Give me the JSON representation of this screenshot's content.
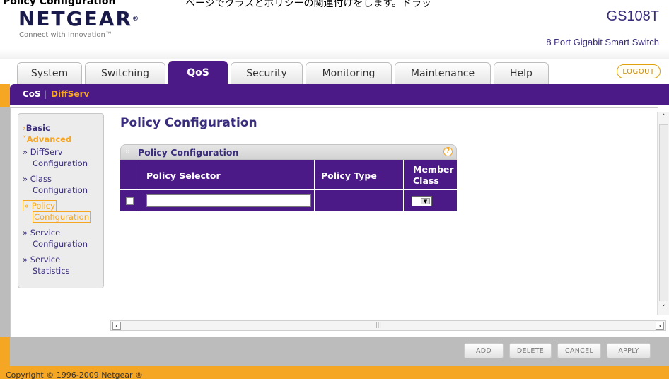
{
  "caption": {
    "left": "Policy Configuration",
    "right": "ページでクラスとポリシーの関連付けをします。ドラッ"
  },
  "header": {
    "brand": "NETGEAR",
    "tagline": "Connect with Innovation™",
    "model": "GS108T",
    "subtitle": "8 Port Gigabit Smart Switch",
    "logout": "LOGOUT"
  },
  "tabs": [
    {
      "label": "System",
      "active": false
    },
    {
      "label": "Switching",
      "active": false
    },
    {
      "label": "QoS",
      "active": true
    },
    {
      "label": "Security",
      "active": false
    },
    {
      "label": "Monitoring",
      "active": false
    },
    {
      "label": "Maintenance",
      "active": false
    },
    {
      "label": "Help",
      "active": false
    }
  ],
  "subnav": {
    "items": [
      "CoS",
      "DiffServ"
    ],
    "separator": "|",
    "active": "DiffServ"
  },
  "sidebar": {
    "basic": "Basic",
    "advanced": "Advanced",
    "items": [
      {
        "line1": "» DiffServ",
        "line2": "Configuration",
        "active": false
      },
      {
        "line1": "» Class",
        "line2": "Configuration",
        "active": false
      },
      {
        "line1": "» Policy",
        "line2": "Configuration",
        "active": true
      },
      {
        "line1": "» Service",
        "line2": "Configuration",
        "active": false
      },
      {
        "line1": "» Service",
        "line2": "Statistics",
        "active": false
      }
    ]
  },
  "main": {
    "page_title": "Policy Configuration",
    "panel_title": "Policy Configuration",
    "help_icon": "?",
    "columns": [
      "Policy Selector",
      "Policy Type",
      "Member Class"
    ],
    "member_class_l1": "Member",
    "member_class_l2": "Class",
    "row": {
      "policy_selector": "",
      "policy_type": "",
      "member_class": ""
    }
  },
  "actions": [
    "ADD",
    "DELETE",
    "CANCEL",
    "APPLY"
  ],
  "footer": "Copyright © 1996-2009 Netgear ®",
  "colors": {
    "purple": "#4b1a87",
    "orange": "#f5a623",
    "gray_bar": "#bcbcbc"
  }
}
